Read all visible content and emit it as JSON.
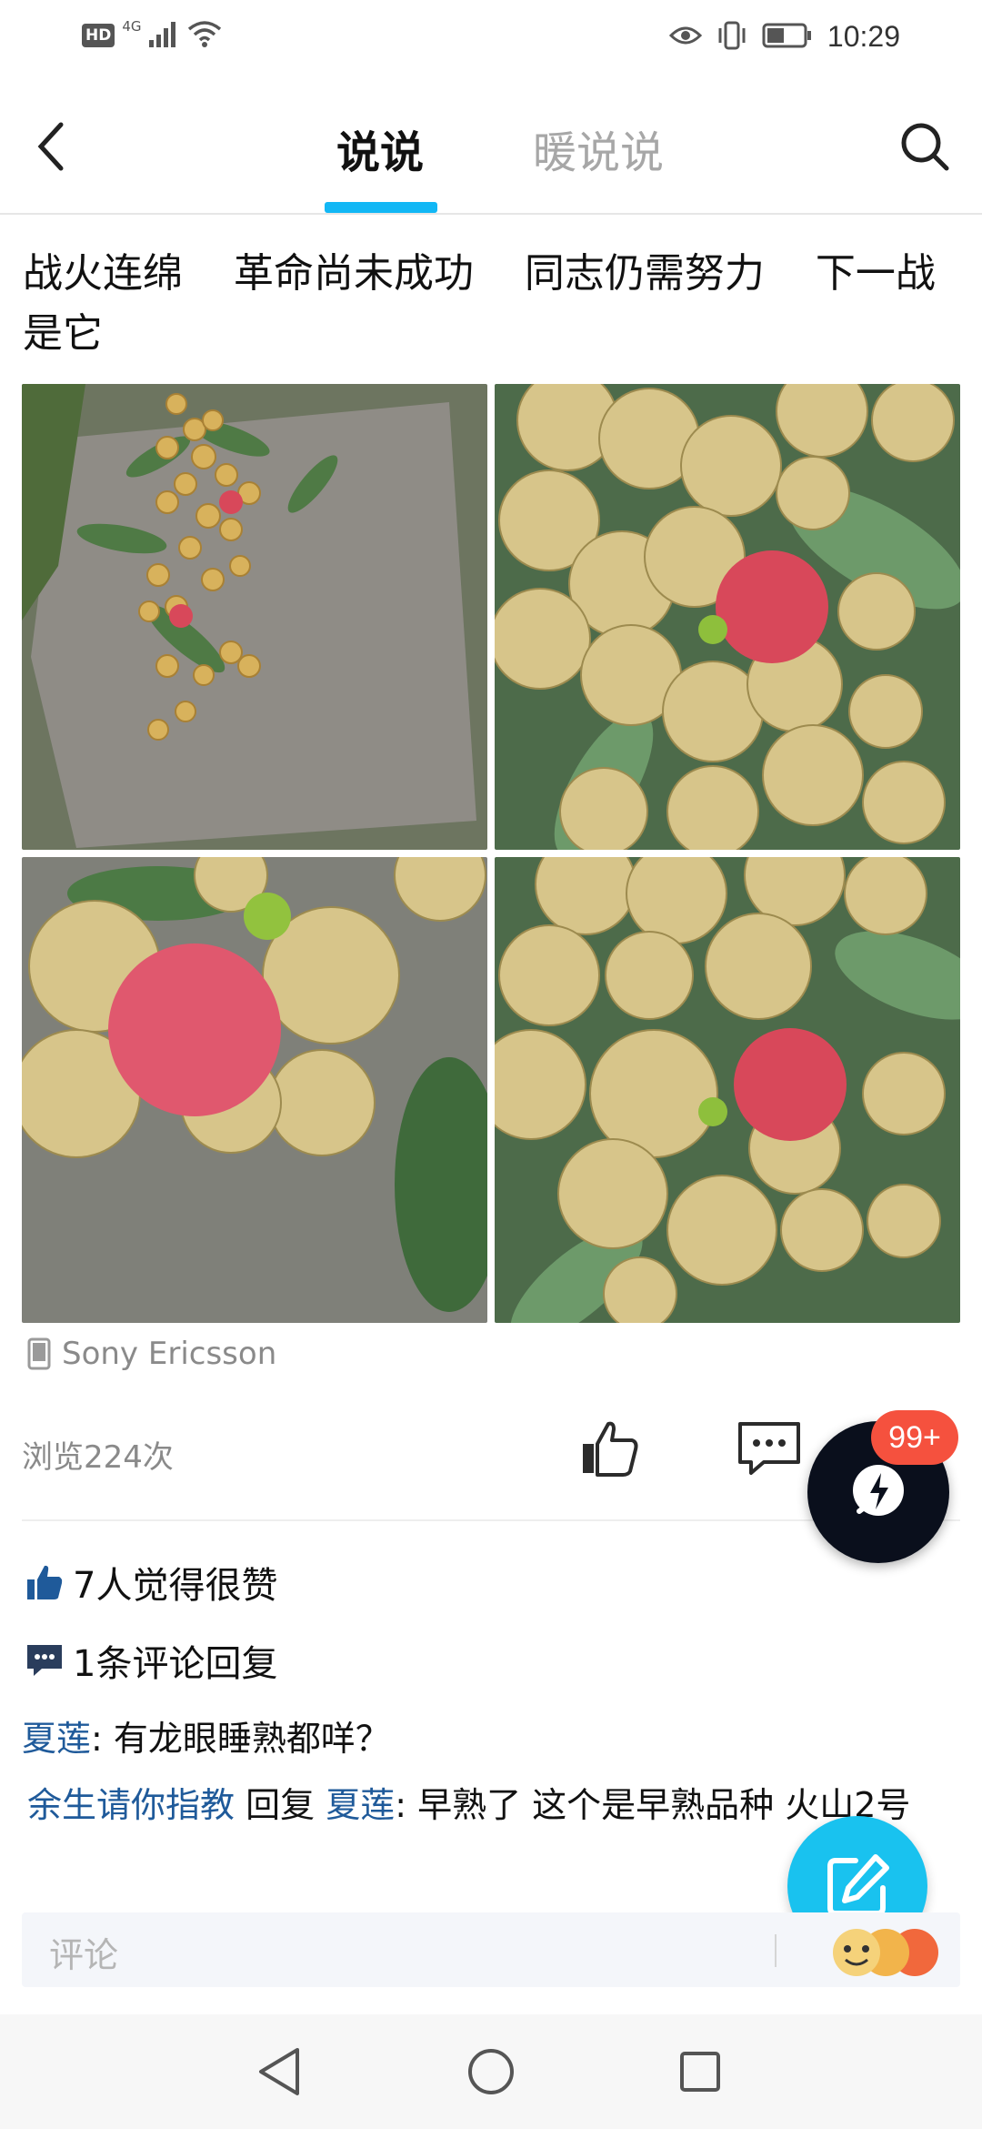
{
  "status_bar": {
    "hd": "HD",
    "network": "4G",
    "time": "10:29"
  },
  "nav": {
    "tabs": [
      {
        "label": "说说",
        "active": true
      },
      {
        "label": "暖说说",
        "active": false
      }
    ],
    "accent_color": "#12b7f5"
  },
  "post": {
    "text": "战火连绵    革命尚未成功    同志仍需努力    下一战是它",
    "photos": [
      {
        "icon": "longan-bunch-on-rock-photo"
      },
      {
        "icon": "longan-lychee-closeup-photo"
      },
      {
        "icon": "lychee-closeup-photo"
      },
      {
        "icon": "longan-lychee-cluster-photo"
      }
    ],
    "device": "Sony Ericsson",
    "views": "浏览224次",
    "badge": "99+"
  },
  "summary": {
    "likes": "7人觉得很赞",
    "comments": "1条评论回复"
  },
  "comments": [
    {
      "user": "夏莲",
      "text": ": 有龙眼睡熟都咩？"
    },
    {
      "user": "余生请你指教",
      "reply_word": " 回复 ",
      "reply_to": "夏莲",
      "text": ": 早熟了   这个是早熟品种   火山2号"
    }
  ],
  "comment_input": {
    "placeholder": "评论"
  }
}
